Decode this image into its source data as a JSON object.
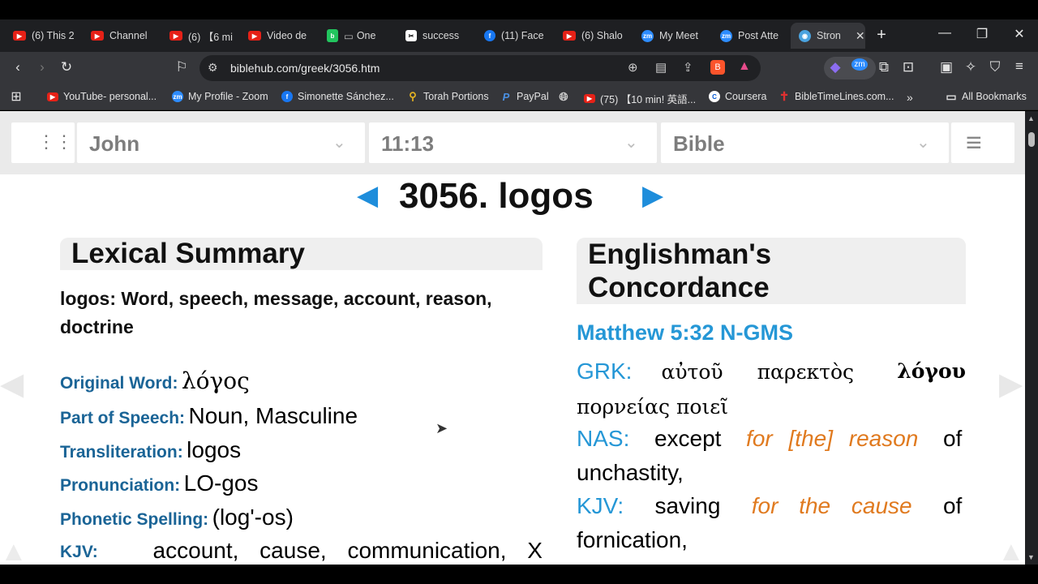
{
  "tabs": [
    {
      "label": "(6) This 2",
      "icon": "youtube-icon"
    },
    {
      "label": "Channel",
      "icon": "youtube-icon"
    },
    {
      "label": "(6) 【6 mi",
      "icon": "youtube-icon"
    },
    {
      "label": "Video de",
      "icon": "youtube-icon"
    },
    {
      "label": "One",
      "icon": "one-icon"
    },
    {
      "label": "success",
      "icon": "capcut-icon"
    },
    {
      "label": "(11) Face",
      "icon": "facebook-icon"
    },
    {
      "label": "(6) Shalo",
      "icon": "youtube-icon"
    },
    {
      "label": "My Meet",
      "icon": "zoom-icon"
    },
    {
      "label": "Post Atte",
      "icon": "zoom-icon"
    },
    {
      "label": "Stron",
      "icon": "biblehub-icon"
    }
  ],
  "url": "biblehub.com/greek/3056.htm",
  "bookmarks": [
    {
      "label": "YouTube- personal..."
    },
    {
      "label": "My Profile - Zoom"
    },
    {
      "label": "Simonette Sánchez..."
    },
    {
      "label": "Torah Portions"
    },
    {
      "label": "PayPal"
    },
    {
      "label": ""
    },
    {
      "label": "(75) 【10 min! 英語..."
    },
    {
      "label": "Coursera"
    },
    {
      "label": "BibleTimeLines.com..."
    }
  ],
  "all_bookmarks": "All Bookmarks",
  "nav": {
    "book": "John",
    "chapter": "11:13",
    "version": "Bible"
  },
  "heading": "3056. logos",
  "lexical": {
    "title": "Lexical Summary",
    "summary": "logos: Word, speech, message, account, reason, doctrine",
    "original_word_label": "Original Word:",
    "original_word": "λόγος",
    "pos_label": "Part of Speech:",
    "pos": "Noun, Masculine",
    "translit_label": "Transliteration:",
    "translit": "logos",
    "pron_label": "Pronunciation:",
    "pron": "LO-gos",
    "phon_label": "Phonetic Spelling:",
    "phon": "(log'-os)",
    "kjv_label": "KJV:",
    "kjv": "account, cause, communication, X"
  },
  "concordance": {
    "title": "Englishman's Concordance",
    "ref": "Matthew 5:32 N-GMS",
    "grk_label": "GRK:",
    "grk_a": "αὐτοῦ παρεκτὸς",
    "grk_bold": "λόγου",
    "grk_b": "πορνείας ποιεῖ",
    "nas_label": "NAS:",
    "nas_a": "except",
    "nas_em": "for [the] reason",
    "nas_b": "of unchastity,",
    "kjv_label": "KJV:",
    "kjv_a": "saving",
    "kjv_em": "for the cause",
    "kjv_b": "of fornication,"
  }
}
